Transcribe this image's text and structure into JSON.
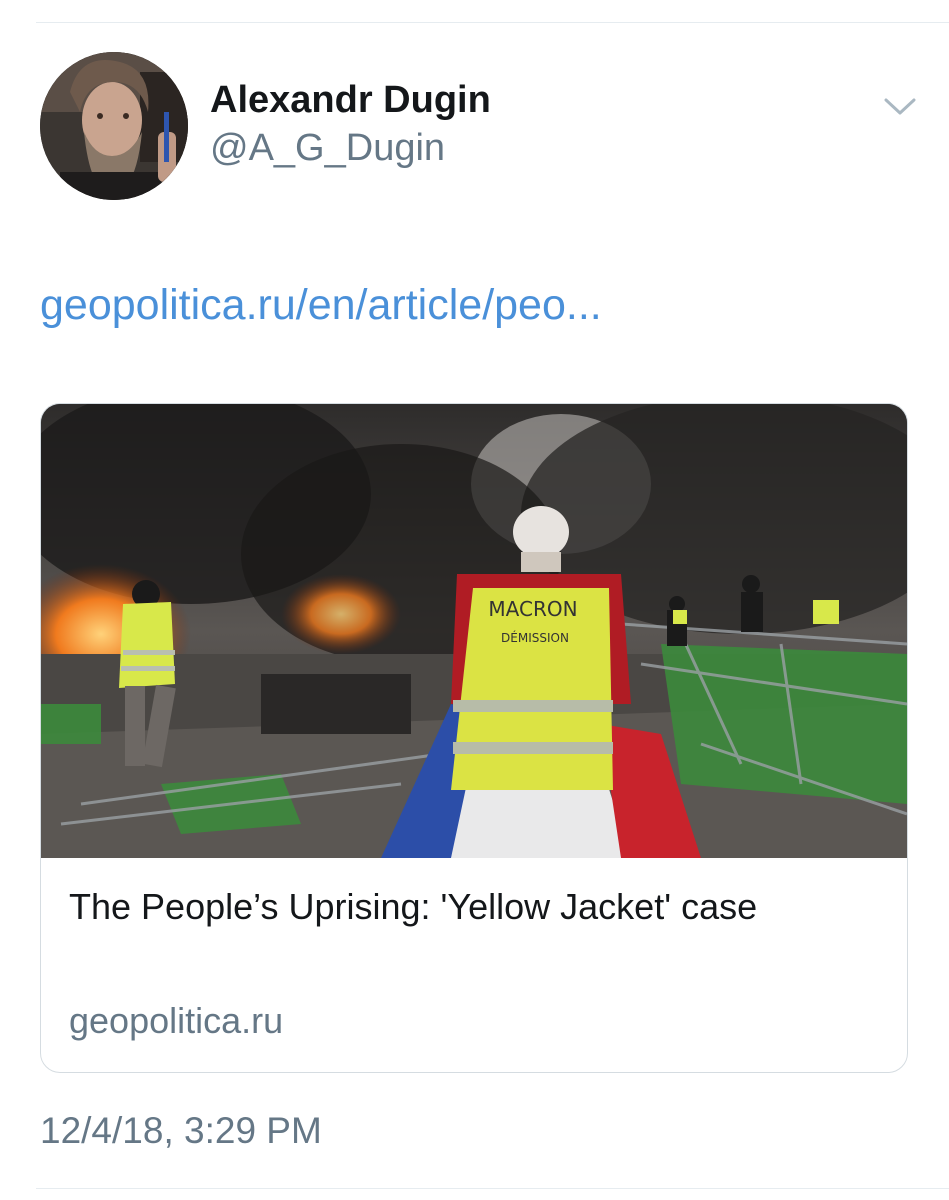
{
  "tweet": {
    "author": {
      "display_name": "Alexandr Dugin",
      "handle": "@A_G_Dugin"
    },
    "link_text": "geopolitica.ru/en/article/peo...",
    "card": {
      "title": "The People’s Uprising: 'Yellow Jacket' case",
      "domain": "geopolitica.ru",
      "vest_text_line1": "MACRON",
      "vest_text_line2": "DÉMISSION"
    },
    "timestamp": "12/4/18, 3:29 PM"
  },
  "icons": {
    "more_options": "chevron-down-icon"
  },
  "colors": {
    "link": "#4a90d9",
    "secondary_text": "#657786",
    "primary_text": "#14171a",
    "border": "#d5dce1"
  }
}
